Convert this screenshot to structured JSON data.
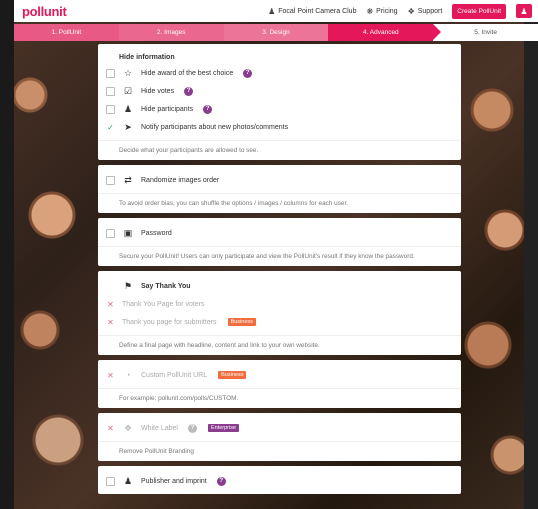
{
  "nav": {
    "logo": "pollunit",
    "club": "Focal Point Camera Club",
    "pricing": "Pricing",
    "support": "Support",
    "create": "Create PollUnit"
  },
  "steps": [
    "1. PollUnit",
    "2. Images",
    "3. Design",
    "4. Advanced",
    "5. Invite"
  ],
  "hide": {
    "title": "Hide information",
    "award": "Hide award of the best choice",
    "votes": "Hide votes",
    "participants": "Hide participants",
    "notify": "Notify participants about new photos/comments",
    "help": "Decide what your participants are allowed to see."
  },
  "randomize": {
    "label": "Randomize images order",
    "help": "To avoid order bias, you can shuffle the options / images / columns for each user."
  },
  "password": {
    "label": "Password",
    "help": "Secure your PollUnit! Users can only participate and view the PollUnit's result if they know the password."
  },
  "thanks": {
    "title": "Say Thank You",
    "voters": "Thank You Page for voters",
    "submitters": "Thank you page for submitters",
    "tag": "Business",
    "help": "Define a final page with headline, content and link to your own website."
  },
  "custom_url": {
    "label": "Custom PollUnit URL",
    "tag": "Business",
    "help": "For example: pollunit.com/polls/CUSTOM."
  },
  "white_label": {
    "label": "White Label",
    "tag": "Enterprise",
    "help": "Remove PollUnit Branding"
  },
  "publisher": {
    "label": "Publisher and imprint"
  },
  "icons": {
    "help": "?",
    "check": "✓",
    "cross": "✕"
  }
}
